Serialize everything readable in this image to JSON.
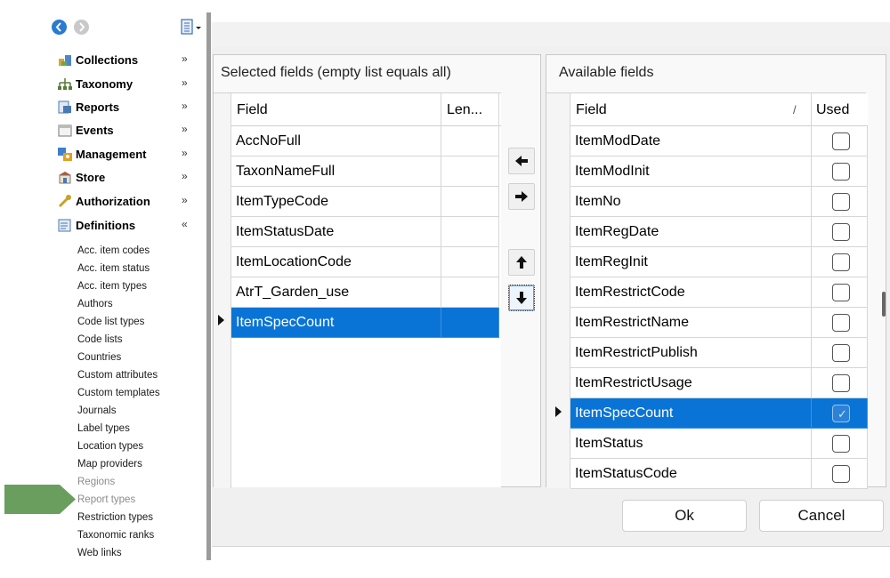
{
  "sidebar": {
    "groups": [
      {
        "label": "Collections",
        "icon": "collections-icon",
        "chevron": "»"
      },
      {
        "label": "Taxonomy",
        "icon": "taxonomy-icon",
        "chevron": "»"
      },
      {
        "label": "Reports",
        "icon": "reports-icon",
        "chevron": "»"
      },
      {
        "label": "Events",
        "icon": "events-icon",
        "chevron": "»"
      },
      {
        "label": "Management",
        "icon": "management-icon",
        "chevron": "»"
      },
      {
        "label": "Store",
        "icon": "store-icon",
        "chevron": "»"
      },
      {
        "label": "Authorization",
        "icon": "authorization-icon",
        "chevron": "»"
      },
      {
        "label": "Definitions",
        "icon": "definitions-icon",
        "chevron": "«"
      }
    ],
    "definitions_items": [
      "Acc. item codes",
      "Acc. item status",
      "Acc. item types",
      "Authors",
      "Code list types",
      "Code lists",
      "Countries",
      "Custom attributes",
      "Custom templates",
      "Journals",
      "Label types",
      "Location types",
      "Map providers",
      "Regions",
      "Report types",
      "Restriction types",
      "Taxonomic ranks",
      "Web links"
    ],
    "highlighted_item": "Report types",
    "pointer_color": "#6a9e5e"
  },
  "selected_fields": {
    "title": "Selected fields (empty list equals all)",
    "columns": [
      "Field",
      "Len..."
    ],
    "rows": [
      "AccNoFull",
      "TaxonNameFull",
      "ItemTypeCode",
      "ItemStatusDate",
      "ItemLocationCode",
      "AtrT_Garden_use",
      "ItemSpecCount"
    ],
    "current_row": "ItemSpecCount"
  },
  "available_fields": {
    "title": "Available fields",
    "columns": [
      "Field",
      "Used"
    ],
    "sort_indicator": "/",
    "rows": [
      {
        "field": "ItemModDate",
        "used": false
      },
      {
        "field": "ItemModInit",
        "used": false
      },
      {
        "field": "ItemNo",
        "used": false
      },
      {
        "field": "ItemRegDate",
        "used": false
      },
      {
        "field": "ItemRegInit",
        "used": false
      },
      {
        "field": "ItemRestrictCode",
        "used": false
      },
      {
        "field": "ItemRestrictName",
        "used": false
      },
      {
        "field": "ItemRestrictPublish",
        "used": false
      },
      {
        "field": "ItemRestrictUsage",
        "used": false
      },
      {
        "field": "ItemSpecCount",
        "used": true
      },
      {
        "field": "ItemStatus",
        "used": false
      },
      {
        "field": "ItemStatusCode",
        "used": false
      }
    ],
    "current_row": "ItemSpecCount"
  },
  "transfer_buttons": [
    "move-left-icon",
    "move-right-icon",
    "move-up-icon",
    "move-down-icon"
  ],
  "buttons": {
    "ok": "Ok",
    "cancel": "Cancel"
  },
  "colors": {
    "selection": "#0a74d6",
    "accent_nav": "#2b79d0"
  }
}
